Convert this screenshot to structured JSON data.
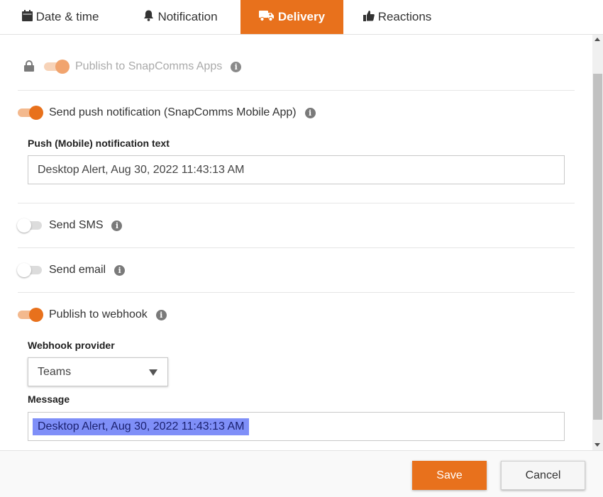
{
  "tabs": [
    {
      "label": "Date & time",
      "icon": "calendar-icon",
      "active": false
    },
    {
      "label": "Notification",
      "icon": "bell-icon",
      "active": false
    },
    {
      "label": "Delivery",
      "icon": "truck-icon",
      "active": true
    },
    {
      "label": "Reactions",
      "icon": "thumbs-up-icon",
      "active": false
    }
  ],
  "help_label": "?",
  "options": {
    "publish_apps": {
      "label": "Publish to SnapComms Apps",
      "on": true,
      "locked": true
    },
    "push": {
      "label": "Send push notification (SnapComms Mobile App)",
      "on": true
    },
    "sms": {
      "label": "Send SMS",
      "on": false
    },
    "email": {
      "label": "Send email",
      "on": false
    },
    "webhook": {
      "label": "Publish to webhook",
      "on": true
    }
  },
  "push_text": {
    "label": "Push (Mobile) notification text",
    "value": "Desktop Alert, Aug 30, 2022 11:43:13 AM"
  },
  "webhook_provider": {
    "label": "Webhook provider",
    "value": "Teams"
  },
  "message": {
    "label": "Message",
    "value": "Desktop Alert, Aug 30, 2022 11:43:13 AM"
  },
  "info_glyph": "i",
  "footer": {
    "save_label": "Save",
    "cancel_label": "Cancel"
  },
  "colors": {
    "accent": "#e8711c",
    "selection": "#7f8ff8"
  }
}
